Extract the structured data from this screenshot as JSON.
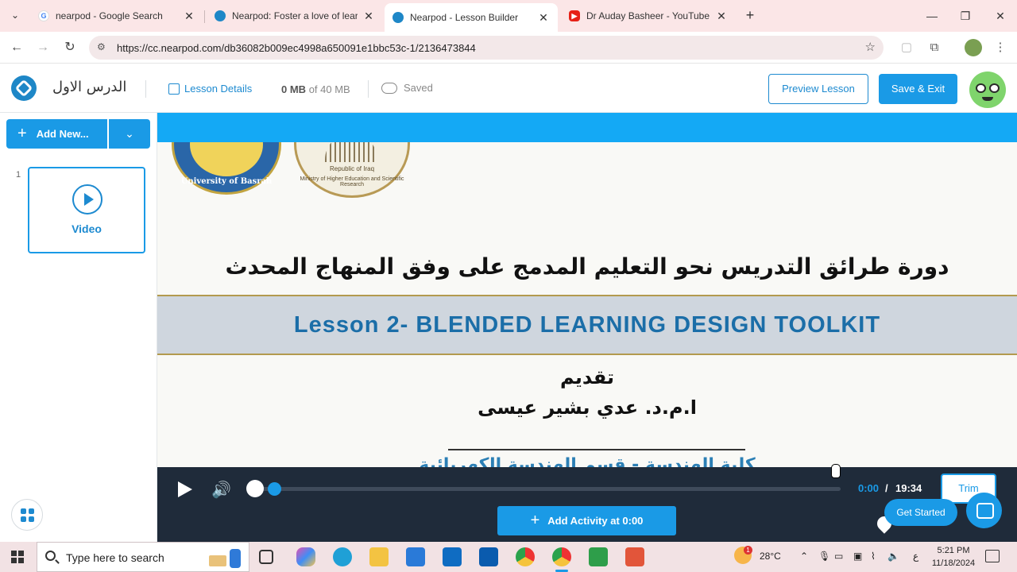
{
  "browser": {
    "tabs": [
      {
        "title": "nearpod - Google Search",
        "favicon": "google-icon",
        "active": false
      },
      {
        "title": "Nearpod: Foster a love of learni",
        "favicon": "nearpod-icon",
        "active": false
      },
      {
        "title": "Nearpod - Lesson Builder",
        "favicon": "nearpod-icon",
        "active": true
      },
      {
        "title": "Dr Auday Basheer - YouTube",
        "favicon": "youtube-icon",
        "active": false
      }
    ],
    "url": "https://cc.nearpod.com/db36082b009ec4998a650091e1bbc53c-1/2136473844"
  },
  "header": {
    "lesson_title": "الدرس الاول",
    "lesson_details_label": "Lesson Details",
    "storage_used": "0 MB",
    "storage_of": "of 40 MB",
    "saved_label": "Saved",
    "preview_label": "Preview Lesson",
    "save_exit_label": "Save & Exit"
  },
  "sidebar": {
    "add_new_label": "Add New...",
    "slides": [
      {
        "number": "1",
        "label": "Video"
      }
    ]
  },
  "video_frame": {
    "logo1_text": "University of Basrah",
    "logo2_text": "Republic of Iraq",
    "logo2_subtext": "Ministry of Higher Education and Scientific Research",
    "course_title": "دورة طرائق التدريس نحو التعليم المدمج على وفق المنهاج المحدث",
    "lesson_banner": "Lesson 2- BLENDED LEARNING DESIGN TOOLKIT",
    "intro_label": "تقديم",
    "presenter": "ا.م.د. عدي بشير عيسى",
    "bottom_text": "كلية الهندسة - قسم الهندسة الكهربائية"
  },
  "player": {
    "current_time": "0:00",
    "separator": "/",
    "total_time": "19:34",
    "trim_label": "Trim",
    "add_activity_label": "Add Activity at 0:00",
    "get_started_label": "Get Started"
  },
  "taskbar": {
    "search_placeholder": "Type here to search",
    "weather": "28°C",
    "lang": "ع",
    "time": "5:21 PM",
    "date": "11/18/2024",
    "weather_badge": "1"
  },
  "colors": {
    "accent": "#1a9ae6",
    "link": "#1d8ad0",
    "banner": "#14a9f5",
    "player_bg": "#1f2b3a"
  }
}
